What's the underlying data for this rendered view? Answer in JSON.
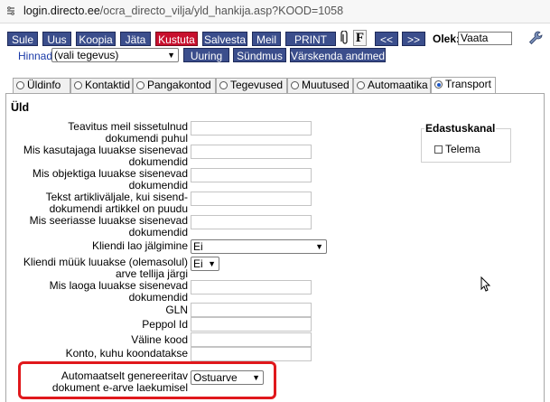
{
  "browser": {
    "url_host": "login.directo.ee",
    "url_path": "/ocra_directo_vilja/yld_hankija.asp?KOOD=1058"
  },
  "toolbar": {
    "buttons": [
      "Sule",
      "Uus",
      "Koopia",
      "Jäta",
      "Kustuta",
      "Salvesta",
      "Meil",
      "PRINT",
      "<<",
      ">>"
    ],
    "attach_icon": "paperclip-icon",
    "f_label": "F",
    "status_label": "Olek:",
    "status_value": "Vaata",
    "tool_icon": "wrench-icon",
    "hinnad_label": "Hinnad",
    "hinnad_value": "(vali tegevus)",
    "uuring_label": "Uuring",
    "syndmus_label": "Sündmus",
    "varskenda_label": "Värskenda andmed"
  },
  "tabs": [
    "Üldinfo",
    "Kontaktid",
    "Pangakontod",
    "Tegevused",
    "Muutused",
    "Automaatika",
    "Transport"
  ],
  "active_tab": "Transport",
  "section_title": "Üld",
  "fields": {
    "f1": "Teavitus meil sissetulnud dokumendi puhul",
    "f2": "Mis kasutajaga luuakse sisenevad dokumendid",
    "f3": "Mis objektiga luuakse sisenevad dokumendid",
    "f4": "Tekst artikliväljale, kui sisend-dokumendi artikkel on puudu",
    "f5": "Mis seeriasse luuakse sisenevad dokumendid",
    "f6": "Kliendi lao jälgimine",
    "f6_value": "Ei",
    "f7": "Kliendi müük luuakse (olemasolul) arve tellija järgi",
    "f7_value": "Ei",
    "f8": "Mis laoga luuakse sisenevad dokumendid",
    "f9": "GLN",
    "f10": "Peppol Id",
    "f11": "Väline kood",
    "f12": "Konto, kuhu koondatakse sisenenud ostuarve read",
    "f13": "Automaatselt genereeritav dokument e-arve laekumisel",
    "f13_value": "Ostuarve"
  },
  "edastuskanal": {
    "title": "Edastuskanal",
    "telema": "Telema"
  },
  "colors": {
    "button_blue": "#3b4e8c",
    "button_red": "#c8102e",
    "highlight": "#e0181c"
  }
}
